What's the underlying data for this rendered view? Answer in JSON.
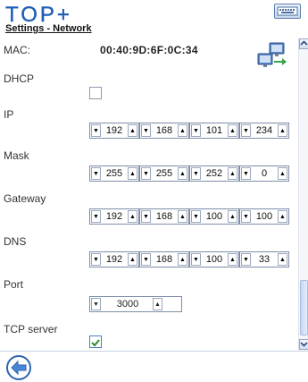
{
  "header": {
    "logo_text": "TOP+",
    "subtitle": "Settings - Network",
    "keyboard_icon": "keyboard-icon"
  },
  "fields": {
    "mac_label": "MAC:",
    "mac_value": "00:40:9D:6F:0C:34",
    "dhcp_label": "DHCP",
    "dhcp_checked": false,
    "ip_label": "IP",
    "ip": [
      "192",
      "168",
      "101",
      "234"
    ],
    "mask_label": "Mask",
    "mask": [
      "255",
      "255",
      "252",
      "0"
    ],
    "gateway_label": "Gateway",
    "gateway": [
      "192",
      "168",
      "100",
      "100"
    ],
    "dns_label": "DNS",
    "dns": [
      "192",
      "168",
      "100",
      "33"
    ],
    "port_label": "Port",
    "port": "3000",
    "tcp_label": "TCP server",
    "tcp_checked": true
  },
  "icons": {
    "network": "network-connection-icon",
    "back": "back-arrow-icon",
    "scroll_up": "scroll-up-icon",
    "scroll_down": "scroll-down-icon",
    "spin_down": "▼",
    "spin_up": "▲"
  },
  "colors": {
    "accent": "#1f5fb8",
    "check": "#2e8b2e"
  }
}
